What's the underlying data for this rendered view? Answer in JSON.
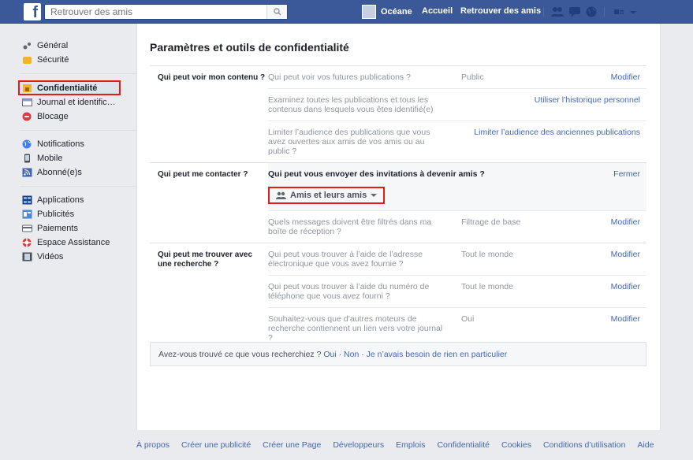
{
  "topbar": {
    "logo": "f",
    "search_placeholder": "Retrouver des amis",
    "user_name": "Océane",
    "home": "Accueil",
    "find_friends": "Retrouver des amis"
  },
  "sidebar": {
    "groups": [
      [
        {
          "label": "Général",
          "icon": "gear-icon"
        },
        {
          "label": "Sécurité",
          "icon": "shield-icon"
        }
      ],
      [
        {
          "label": "Confidentialité",
          "icon": "lock-icon",
          "active": true
        },
        {
          "label": "Journal et identific…",
          "icon": "timeline-icon"
        },
        {
          "label": "Blocage",
          "icon": "block-icon"
        }
      ],
      [
        {
          "label": "Notifications",
          "icon": "globe-icon"
        },
        {
          "label": "Mobile",
          "icon": "mobile-icon"
        },
        {
          "label": "Abonné(e)s",
          "icon": "rss-icon"
        }
      ],
      [
        {
          "label": "Applications",
          "icon": "apps-icon"
        },
        {
          "label": "Publicités",
          "icon": "ads-icon"
        },
        {
          "label": "Paiements",
          "icon": "card-icon"
        },
        {
          "label": "Espace Assistance",
          "icon": "lifebuoy-icon"
        },
        {
          "label": "Vidéos",
          "icon": "film-icon"
        }
      ]
    ]
  },
  "main": {
    "title": "Paramètres et outils de confidentialité",
    "sections": [
      {
        "label": "Qui peut voir mon contenu ?",
        "rows": [
          {
            "q": "Qui peut voir vos futures publications ?",
            "val": "Public",
            "act": "Modifier"
          },
          {
            "q": "Examinez toutes les publications et tous les contenus dans lesquels vous êtes identifié(e)",
            "val": "",
            "act": "Utiliser l’historique personnel"
          },
          {
            "q": "Limiter l’audience des publications que vous avez ouvertes aux amis de vos amis ou au public ?",
            "val": "",
            "act": "Limiter l’audience des anciennes publications"
          }
        ]
      },
      {
        "label": "Qui peut me contacter ?",
        "rows": [
          {
            "q": "Qui peut vous envoyer des invitations à devenir amis ?",
            "val": "",
            "act": "Fermer",
            "expanded": true,
            "audience": "Amis et leurs amis"
          },
          {
            "q": "Quels messages doivent être filtrés dans ma boîte de réception ?",
            "val": "Filtrage de base",
            "act": "Modifier"
          }
        ]
      },
      {
        "label": "Qui peut me trouver avec une recherche ?",
        "rows": [
          {
            "q": "Qui peut vous trouver à l’aide de l’adresse électronique que vous avez fournie ?",
            "val": "Tout le monde",
            "act": "Modifier"
          },
          {
            "q": "Qui peut vous trouver à l’aide du numéro de téléphone que vous avez fourni ?",
            "val": "Tout le monde",
            "act": "Modifier"
          },
          {
            "q": "Souhaitez-vous que d’autres moteurs de recherche contiennent un lien vers votre journal ?",
            "val": "Oui",
            "act": "Modifier"
          }
        ]
      }
    ],
    "feedback": {
      "question": "Avez-vous trouvé ce que vous recherchiez ?",
      "yes": "Oui",
      "sep1": " · ",
      "no": "Non",
      "sep2": " · ",
      "nothing": "Je n’avais besoin de rien en particulier"
    }
  },
  "footer": [
    "À propos",
    "Créer une publicité",
    "Créer une Page",
    "Développeurs",
    "Emplois",
    "Confidentialité",
    "Cookies",
    "Conditions d’utilisation",
    "Aide"
  ],
  "colors": {
    "brand": "#3b5998",
    "link": "#4267b2",
    "highlight": "#e41b17"
  }
}
